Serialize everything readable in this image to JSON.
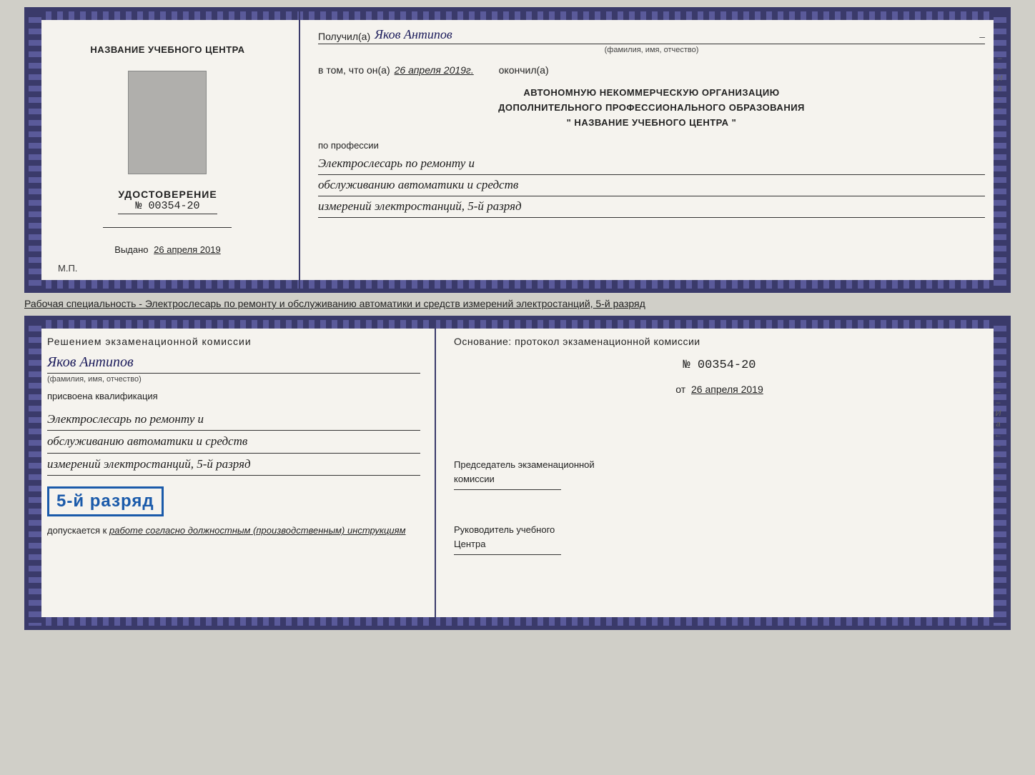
{
  "top_card": {
    "left": {
      "org_name": "НАЗВАНИЕ УЧЕБНОГО ЦЕНТРА",
      "udostoverenie_title": "УДОСТОВЕРЕНИЕ",
      "udostoverenie_number": "№ 00354-20",
      "vydano_label": "Выдано",
      "vydano_date": "26 апреля 2019",
      "mp_label": "М.П."
    },
    "right": {
      "poluchil_label": "Получил(а)",
      "receiver_name": "Яков Антипов",
      "fio_sub": "(фамилия, имя, отчество)",
      "vtom_label": "в том, что он(а)",
      "vtom_date": "26 апреля 2019г.",
      "okonchil_label": "окончил(а)",
      "org_line1": "АВТОНОМНУЮ НЕКОММЕРЧЕСКУЮ ОРГАНИЗАЦИЮ",
      "org_line2": "ДОПОЛНИТЕЛЬНОГО ПРОФЕССИОНАЛЬНОГО ОБРАЗОВАНИЯ",
      "org_line3": "\"  НАЗВАНИЕ УЧЕБНОГО ЦЕНТРА  \"",
      "po_professii": "по профессии",
      "specialty_line1": "Электрослесарь по ремонту и",
      "specialty_line2": "обслуживанию автоматики и средств",
      "specialty_line3": "измерений электростанций, 5-й разряд"
    }
  },
  "separator_text": "Рабочая специальность - Электрослесарь по ремонту и обслуживанию автоматики и средств измерений электростанций, 5-й разряд",
  "bottom_card": {
    "left": {
      "reshenie_label": "Решением экзаменационной комиссии",
      "name_value": "Яков Антипов",
      "fio_sub": "(фамилия, имя, отчество)",
      "prisvoena_label": "присвоена квалификация",
      "specialty_line1": "Электрослесарь по ремонту и",
      "specialty_line2": "обслуживанию автоматики и средств",
      "specialty_line3": "измерений электростанций, 5-й разряд",
      "razryad_badge": "5-й разряд",
      "dopuskaetsya_prefix": "допускается к",
      "dopuskaetsya_text": "работе согласно должностным (производственным) инструкциям"
    },
    "right": {
      "osnovanie_label": "Основание: протокол экзаменационной комиссии",
      "protocol_number": "№ 00354-20",
      "ot_label": "от",
      "ot_date": "26 апреля 2019",
      "predsedatel_line1": "Председатель экзаменационной",
      "predsedatel_line2": "комиссии",
      "rukovoditel_line1": "Руководитель учебного",
      "rukovoditel_line2": "Центра"
    }
  }
}
